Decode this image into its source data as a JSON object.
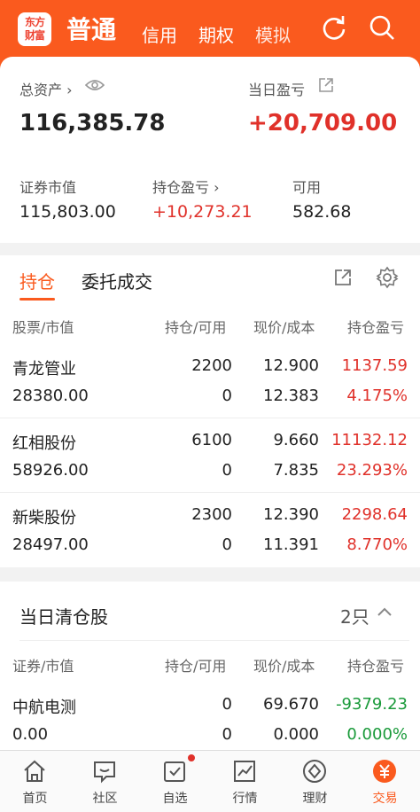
{
  "header": {
    "logo_line1": "东方",
    "logo_line2": "财富",
    "tab_active": "普通",
    "tabs": [
      "信用",
      "期权",
      "模拟"
    ]
  },
  "summary": {
    "total_assets_label": "总资产",
    "total_assets": "116,385.78",
    "today_pnl_label": "当日盈亏",
    "today_pnl": "+20,709.00",
    "market_value_label": "证券市值",
    "market_value": "115,803.00",
    "position_pnl_label": "持仓盈亏",
    "position_pnl": "+10,273.21",
    "available_label": "可用",
    "available": "582.68"
  },
  "positions": {
    "tab_active": "持仓",
    "tab_other": "委托成交",
    "columns": [
      "股票/市值",
      "持仓/可用",
      "现价/成本",
      "持仓盈亏"
    ],
    "rows": [
      {
        "name": "青龙管业",
        "value": "28380.00",
        "hold": "2200",
        "avail": "0",
        "price": "12.900",
        "cost": "12.383",
        "pnl": "1137.59",
        "pnl_pct": "4.175%"
      },
      {
        "name": "红相股份",
        "value": "58926.00",
        "hold": "6100",
        "avail": "0",
        "price": "9.660",
        "cost": "7.835",
        "pnl": "11132.12",
        "pnl_pct": "23.293%"
      },
      {
        "name": "新柴股份",
        "value": "28497.00",
        "hold": "2300",
        "avail": "0",
        "price": "12.390",
        "cost": "11.391",
        "pnl": "2298.64",
        "pnl_pct": "8.770%"
      }
    ]
  },
  "cleared": {
    "title": "当日清仓股",
    "count": "2只",
    "columns": [
      "证券/市值",
      "持仓/可用",
      "现价/成本",
      "持仓盈亏"
    ],
    "rows": [
      {
        "name": "中航电测",
        "value": "0.00",
        "hold": "0",
        "avail": "0",
        "price": "69.670",
        "cost": "0.000",
        "pnl": "-9379.23",
        "pnl_pct": "0.000%"
      }
    ]
  },
  "nav": {
    "items": [
      "首页",
      "社区",
      "自选",
      "行情",
      "理财",
      "交易"
    ]
  },
  "colors": {
    "brand": "#fa5a1e",
    "up": "#e0312a",
    "down": "#1a9a3a"
  }
}
